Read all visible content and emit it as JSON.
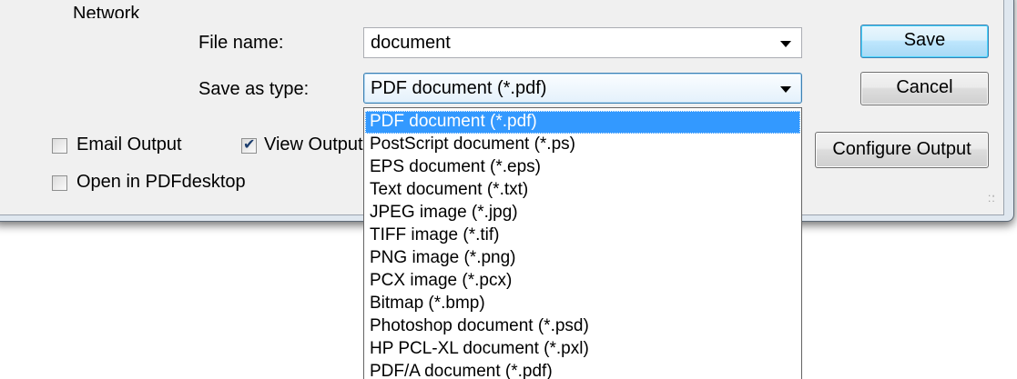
{
  "dialog": {
    "places_label": "Network",
    "file_name_label": "File name:",
    "file_name_value": "document",
    "save_as_type_label": "Save as type:",
    "save_as_type_value": "PDF document (*.pdf)",
    "save_button": "Save",
    "cancel_button": "Cancel",
    "configure_output_button": "Configure Output"
  },
  "options": {
    "email_output": {
      "label": "Email Output",
      "checked": false
    },
    "view_output": {
      "label": "View Output",
      "checked": true
    },
    "open_in_pdfdesktop": {
      "label": "Open in PDFdesktop",
      "checked": false
    }
  },
  "file_types": [
    "PDF document (*.pdf)",
    "PostScript document (*.ps)",
    "EPS document (*.eps)",
    "Text document (*.txt)",
    "JPEG image (*.jpg)",
    "TIFF image (*.tif)",
    "PNG image (*.png)",
    "PCX image (*.pcx)",
    "Bitmap (*.bmp)",
    "Photoshop document (*.psd)",
    "HP PCL-XL document (*.pxl)",
    "PDF/A document (*.pdf)"
  ],
  "selected_type_index": 0,
  "icons": {
    "combo_arrow": "chevron-down-icon",
    "checkmark": "checkmark-icon",
    "size_grip": "resize-grip-icon"
  },
  "colors": {
    "selection": "#3399ff",
    "dialog_bg": "#f0f0f0",
    "default_button_border": "#3c7fb1"
  }
}
